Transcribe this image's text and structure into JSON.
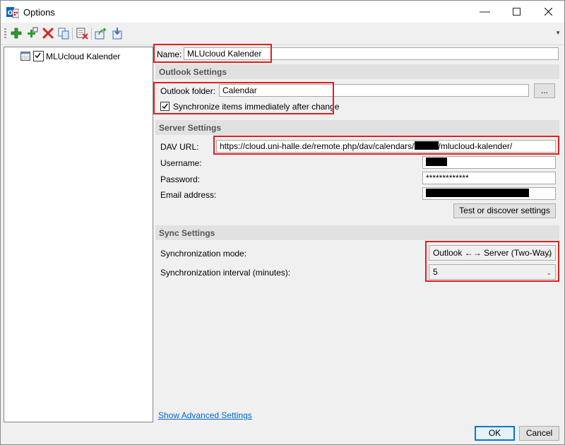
{
  "window": {
    "title": "Options",
    "app_icon": "outlook-caldav-icon",
    "controls": [
      "minimize-icon",
      "maximize-icon",
      "close-icon"
    ]
  },
  "toolbar": {
    "buttons": [
      {
        "name": "add-profile",
        "icon": "green-plus-icon"
      },
      {
        "name": "add-multiple-profiles",
        "icon": "add-multiple-icon"
      },
      {
        "name": "delete-profile",
        "icon": "red-x-icon"
      },
      {
        "name": "copy-profile",
        "icon": "copy-icon"
      },
      {
        "name": "clear-cache",
        "icon": "clear-cache-icon"
      },
      {
        "name": "export-options",
        "icon": "export-icon"
      },
      {
        "name": "import-options",
        "icon": "import-icon"
      }
    ]
  },
  "tree": {
    "items": [
      {
        "label": "MLUcloud Kalender",
        "checked": true,
        "icon": "calendar-icon"
      }
    ]
  },
  "form": {
    "name_label": "Name:",
    "name_value": "MLUcloud Kalender",
    "outlook_section": "Outlook Settings",
    "outlook_folder_label": "Outlook folder:",
    "outlook_folder_value": "Calendar",
    "browse_label": "...",
    "sync_immediately_label": "Synchronize items immediately after change",
    "sync_immediately_checked": true,
    "server_section": "Server Settings",
    "dav_url_label": "DAV URL:",
    "dav_url_prefix": "https://cloud.uni-halle.de/remote.php/dav/calendars/",
    "dav_url_suffix": "/mlucloud-kalender/",
    "username_label": "Username:",
    "password_label": "Password:",
    "password_value": "*************",
    "email_label": "Email address:",
    "test_button": "Test or discover settings",
    "sync_section": "Sync Settings",
    "sync_mode_label": "Synchronization mode:",
    "sync_mode_value": "Outlook ←→ Server (Two-Way)",
    "sync_interval_label": "Synchronization interval (minutes):",
    "sync_interval_value": "5",
    "advanced_link": "Show Advanced Settings"
  },
  "footer": {
    "ok_label": "OK",
    "cancel_label": "Cancel"
  },
  "colors": {
    "highlight": "#e0201c",
    "link": "#0066cc",
    "section_bg": "#e1e1e1"
  }
}
